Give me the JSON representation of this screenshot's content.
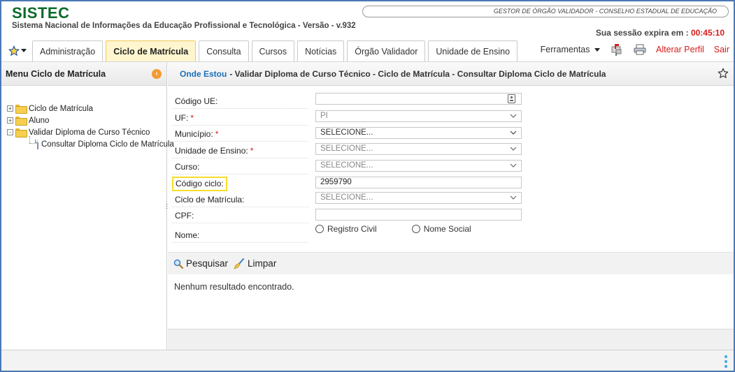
{
  "header": {
    "logo": "SISTEC",
    "subtitle": "Sistema Nacional de Informações da Educação Profissional e Tecnológica - Versão - v.932",
    "user_role": "GESTOR DE ÓRGÃO VALIDADOR - CONSELHO ESTADUAL DE EDUCAÇÃO",
    "session_label": "Sua sessão expira em :",
    "session_time": "00:45:10"
  },
  "tabs": [
    {
      "label": "Administração"
    },
    {
      "label": "Ciclo de Matrícula",
      "active": true
    },
    {
      "label": "Consulta"
    },
    {
      "label": "Cursos"
    },
    {
      "label": "Notícias"
    },
    {
      "label": "Órgão Validador"
    },
    {
      "label": "Unidade de Ensino"
    }
  ],
  "tools": {
    "ferramentas": "Ferramentas",
    "alterar_perfil": "Alterar Perfil",
    "sair": "Sair"
  },
  "sidebar": {
    "title": "Menu Ciclo de Matrícula",
    "tree": [
      {
        "label": "Ciclo de Matrícula",
        "expander": "+"
      },
      {
        "label": "Aluno",
        "expander": "+"
      },
      {
        "label": "Validar Diploma de Curso Técnico",
        "expander": "-"
      },
      {
        "label": "Consultar Diploma Ciclo de Matrícula"
      }
    ]
  },
  "breadcrumb": {
    "where": "Onde Estou",
    "path": "- Validar Diploma de Curso Técnico - Ciclo de Matrícula - Consultar Diploma Ciclo de Matrícula"
  },
  "form": {
    "codigo_ue": {
      "label": "Código UE:",
      "value": ""
    },
    "uf": {
      "label": "UF:",
      "value": "PI"
    },
    "municipio": {
      "label": "Município:",
      "value": "SELECIONE..."
    },
    "unidade_ensino": {
      "label": "Unidade de Ensino:",
      "value": "SELECIONE..."
    },
    "curso": {
      "label": "Curso:",
      "value": "SELECIONE..."
    },
    "codigo_ciclo": {
      "label": "Código ciclo:",
      "value": "2959790"
    },
    "ciclo_matricula": {
      "label": "Ciclo de Matrícula:",
      "value": "SELECIONE..."
    },
    "cpf": {
      "label": "CPF:",
      "value": ""
    },
    "nome": {
      "label": "Nome:",
      "options": [
        "Registro Civil",
        "Nome Social"
      ]
    },
    "required_mark": "*"
  },
  "actions": {
    "search": "Pesquisar",
    "clear": "Limpar"
  },
  "result_text": "Nenhum resultado encontrado.",
  "colors": {
    "logo": "#0b6b2a",
    "accent_red": "#d81b1b",
    "link_blue": "#1e6fb8",
    "active_tab": "#fff6cf",
    "highlight": "#f5df2a"
  }
}
